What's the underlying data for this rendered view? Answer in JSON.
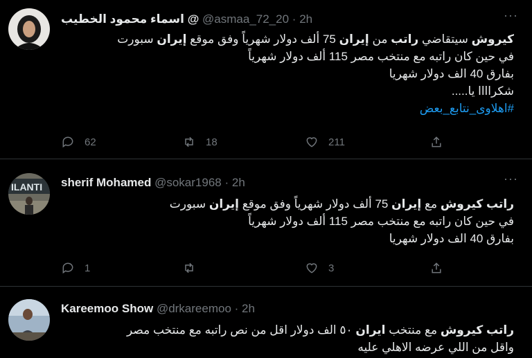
{
  "tweets": [
    {
      "name": "اسماء محمود الخطيب @",
      "handle": "@asmaa_72_20",
      "time": "2h",
      "lines": [
        [
          {
            "t": "كيروش",
            "b": true
          },
          {
            "t": " سيتقاضي "
          },
          {
            "t": "راتب",
            "b": true
          },
          {
            "t": " من "
          },
          {
            "t": "إيران",
            "b": true
          },
          {
            "t": " 75 ألف دولار شهرياً وفق موقع "
          },
          {
            "t": "إيران",
            "b": true
          },
          {
            "t": " سبورت"
          }
        ],
        [
          {
            "t": "في حين كان راتبه مع منتخب مصر 115 ألف دولار شهرياً"
          }
        ],
        [
          {
            "t": "بفارق 40 الف دولار شهريا"
          }
        ],
        [
          {
            "t": "شكراااا يا....."
          }
        ]
      ],
      "hashtag": "#اهلاوى_نتابع_بعض",
      "replies": "62",
      "retweets": "18",
      "likes": "211"
    },
    {
      "name": "sherif Mohamed",
      "handle": "@sokar1968",
      "time": "2h",
      "lines": [
        [
          {
            "t": "راتب كيروش",
            "b": true
          },
          {
            "t": " مع "
          },
          {
            "t": "إيران",
            "b": true
          },
          {
            "t": " 75 ألف دولار شهرياً وفق موقع "
          },
          {
            "t": "إيران",
            "b": true
          },
          {
            "t": " سبورت"
          }
        ],
        [
          {
            "t": "في حين كان راتبه مع منتخب مصر 115 ألف دولار شهرياً"
          }
        ],
        [
          {
            "t": "بفارق 40 الف دولار شهريا"
          }
        ]
      ],
      "replies": "1",
      "retweets": "",
      "likes": "3"
    },
    {
      "name": "Kareemoo Show",
      "handle": "@drkareemoo",
      "time": "2h",
      "lines": [
        [
          {
            "t": "راتب كيروش",
            "b": true
          },
          {
            "t": " مع منتخب "
          },
          {
            "t": "ايران",
            "b": true
          },
          {
            "t": " ٥٠ الف دولار اقل من نص راتبه مع منتخب مصر"
          }
        ],
        [
          {
            "t": "واقل من اللي عرضه الاهلي عليه"
          }
        ]
      ]
    }
  ],
  "separator": "·",
  "more_label": "···"
}
